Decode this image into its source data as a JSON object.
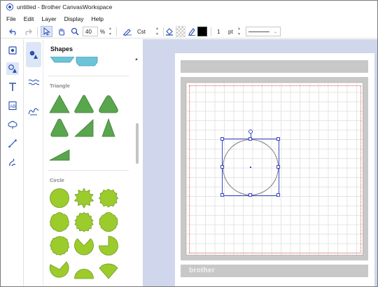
{
  "window": {
    "title": "untitled - Brother CanvasWorkspace"
  },
  "menu": [
    "File",
    "Edit",
    "Layer",
    "Display",
    "Help"
  ],
  "toolbar": {
    "zoom_value": "40",
    "zoom_unit": "%",
    "line_mode": "Cst",
    "line_width_value": "1",
    "line_width_unit": "pt"
  },
  "panel": {
    "title": "Shapes",
    "sections": {
      "triangle": "Triangle",
      "circle": "Circle"
    }
  },
  "mat": {
    "brand": "brother"
  },
  "colors": {
    "accent": "#2b4fb3",
    "shape_green": "#5aa64e",
    "shape_lime": "#9ccc2c",
    "shape_teal": "#6cc4d8",
    "canvas_bg": "#d0d6ec",
    "selection": "#3b46c4"
  }
}
